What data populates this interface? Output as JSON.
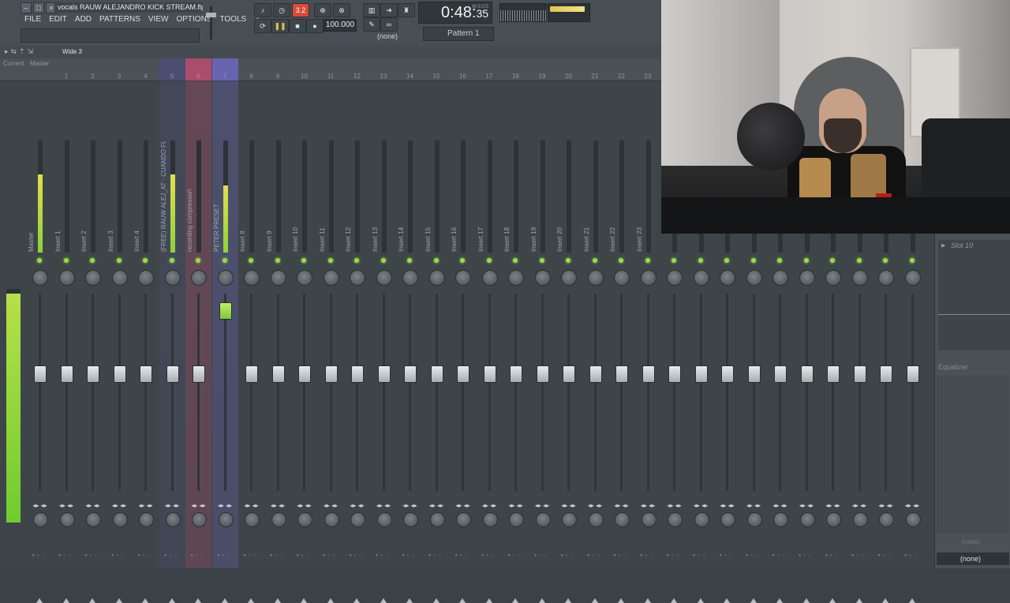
{
  "window": {
    "file_title": "vocals RAUW ALEJANDRO KICK STREAM.flp"
  },
  "menu": [
    "FILE",
    "EDIT",
    "ADD",
    "PATTERNS",
    "VIEW",
    "OPTIONS",
    "TOOLS",
    "?"
  ],
  "transport": {
    "tempo": "100.000",
    "time_main": "0:48:",
    "time_frac": "35",
    "time_label": "M:S:CS",
    "pattern": "Pattern 1",
    "snap": "(none)",
    "counter": "3.2"
  },
  "mixer": {
    "view_label": "Wide 3",
    "current_label": "Current",
    "master_label": "Master",
    "tracks": [
      {
        "num": "",
        "name": "Master",
        "meter": 0.7,
        "fader": 0.5,
        "highlight": ""
      },
      {
        "num": "1",
        "name": "Insert 1",
        "meter": 0,
        "fader": 0.5,
        "highlight": ""
      },
      {
        "num": "2",
        "name": "Insert 2",
        "meter": 0,
        "fader": 0.5,
        "highlight": ""
      },
      {
        "num": "3",
        "name": "Insert 3",
        "meter": 0,
        "fader": 0.5,
        "highlight": ""
      },
      {
        "num": "4",
        "name": "Insert 4",
        "meter": 0,
        "fader": 0.5,
        "highlight": ""
      },
      {
        "num": "5",
        "name": "(FREE) RAUW ALEJ_AT - CUANDO FUE...",
        "meter": 0.7,
        "fader": 0.5,
        "highlight": "#4b4d74"
      },
      {
        "num": "6",
        "name": "recording compressor\\",
        "meter": 0,
        "fader": 0.5,
        "highlight": "#b54b6d"
      },
      {
        "num": "7",
        "name": "PETER PRESET",
        "meter": 0.6,
        "fader": 0.82,
        "highlight": "#6b66b8"
      },
      {
        "num": "8",
        "name": "Insert 8",
        "meter": 0,
        "fader": 0.5,
        "highlight": ""
      },
      {
        "num": "9",
        "name": "Insert 9",
        "meter": 0,
        "fader": 0.5,
        "highlight": ""
      },
      {
        "num": "10",
        "name": "Insert 10",
        "meter": 0,
        "fader": 0.5,
        "highlight": ""
      },
      {
        "num": "11",
        "name": "Insert 11",
        "meter": 0,
        "fader": 0.5,
        "highlight": ""
      },
      {
        "num": "12",
        "name": "Insert 12",
        "meter": 0,
        "fader": 0.5,
        "highlight": ""
      },
      {
        "num": "13",
        "name": "Insert 13",
        "meter": 0,
        "fader": 0.5,
        "highlight": ""
      },
      {
        "num": "14",
        "name": "Insert 14",
        "meter": 0,
        "fader": 0.5,
        "highlight": ""
      },
      {
        "num": "15",
        "name": "Insert 15",
        "meter": 0,
        "fader": 0.5,
        "highlight": ""
      },
      {
        "num": "16",
        "name": "Insert 16",
        "meter": 0,
        "fader": 0.5,
        "highlight": ""
      },
      {
        "num": "17",
        "name": "Insert 17",
        "meter": 0,
        "fader": 0.5,
        "highlight": ""
      },
      {
        "num": "18",
        "name": "Insert 18",
        "meter": 0,
        "fader": 0.5,
        "highlight": ""
      },
      {
        "num": "19",
        "name": "Insert 19",
        "meter": 0,
        "fader": 0.5,
        "highlight": ""
      },
      {
        "num": "20",
        "name": "Insert 20",
        "meter": 0,
        "fader": 0.5,
        "highlight": ""
      },
      {
        "num": "21",
        "name": "Insert 21",
        "meter": 0,
        "fader": 0.5,
        "highlight": ""
      },
      {
        "num": "22",
        "name": "Insert 22",
        "meter": 0,
        "fader": 0.5,
        "highlight": ""
      },
      {
        "num": "23",
        "name": "Insert 23",
        "meter": 0,
        "fader": 0.5,
        "highlight": ""
      },
      {
        "num": "",
        "name": "",
        "meter": 0,
        "fader": 0.5,
        "highlight": ""
      },
      {
        "num": "",
        "name": "",
        "meter": 0,
        "fader": 0.5,
        "highlight": ""
      },
      {
        "num": "",
        "name": "",
        "meter": 0,
        "fader": 0.5,
        "highlight": ""
      },
      {
        "num": "",
        "name": "",
        "meter": 0,
        "fader": 0.5,
        "highlight": ""
      },
      {
        "num": "",
        "name": "",
        "meter": 0,
        "fader": 0.5,
        "highlight": ""
      },
      {
        "num": "",
        "name": "",
        "meter": 0,
        "fader": 0.5,
        "highlight": ""
      },
      {
        "num": "",
        "name": "",
        "meter": 0,
        "fader": 0.5,
        "highlight": ""
      },
      {
        "num": "",
        "name": "",
        "meter": 0,
        "fader": 0.5,
        "highlight": ""
      },
      {
        "num": "",
        "name": "",
        "meter": 0,
        "fader": 0.5,
        "highlight": ""
      },
      {
        "num": "",
        "name": "",
        "meter": 0,
        "fader": 0.5,
        "highlight": ""
      }
    ],
    "master_level": 0.98
  },
  "fx_panel": {
    "slot_label": "Slot 10",
    "eq_label": "Equalizer",
    "out_a": "(none)",
    "out_b": "(none)"
  },
  "colors": {
    "meter_green": "#9bdc45",
    "accent_yellow": "#e0c251",
    "record_red": "#e8513a"
  },
  "icons": [
    "minimize-icon",
    "restore-icon",
    "close-icon",
    "play-icon",
    "stop-icon",
    "record-icon",
    "loop-icon"
  ]
}
